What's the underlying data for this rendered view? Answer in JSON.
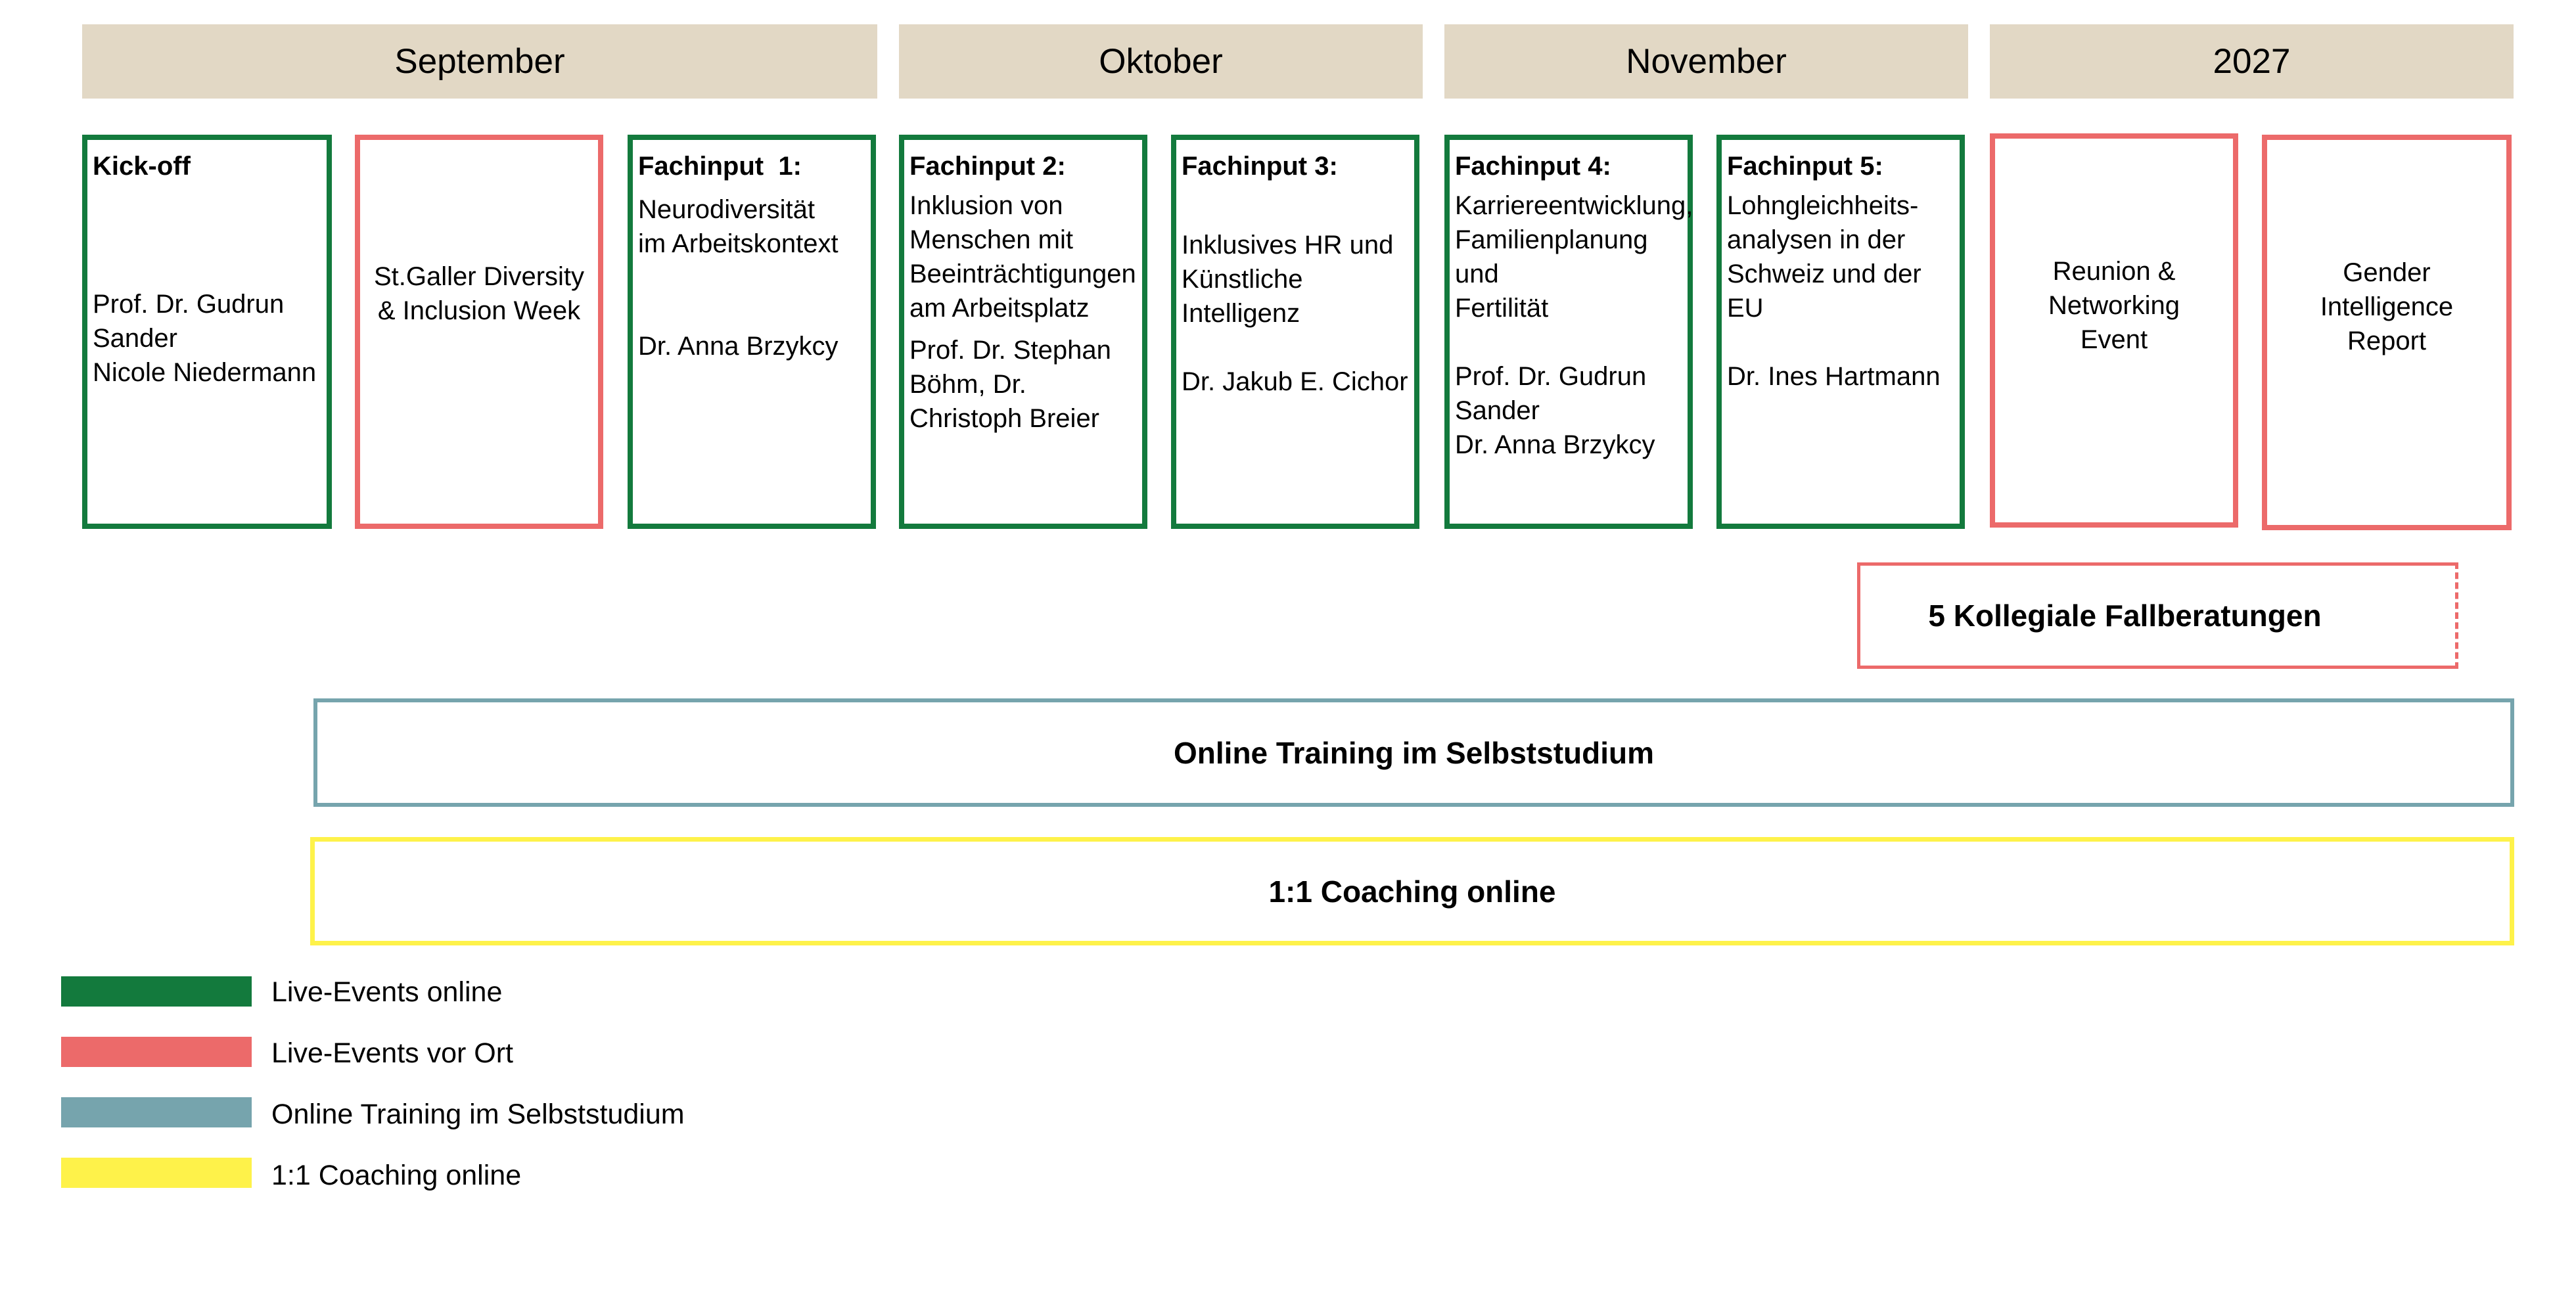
{
  "months": [
    "September",
    "Oktober",
    "November",
    "2027"
  ],
  "cards": {
    "kickoff": {
      "title": "Kick-off",
      "lines": [
        "Prof. Dr. Gudrun",
        "Sander",
        "Nicole Niedermann"
      ]
    },
    "stgaller": {
      "lines": [
        "St.Galler Diversity",
        "& Inclusion Week"
      ]
    },
    "fach1": {
      "title": "Fachinput  1:",
      "topic": [
        "Neurodiversität",
        "im Arbeitskontext"
      ],
      "speakers": [
        "Dr. Anna Brzykcy"
      ]
    },
    "fach2": {
      "title": "Fachinput 2:",
      "topic": [
        "Inklusion von",
        "Menschen mit",
        "Beeinträchtigungen",
        "am Arbeitsplatz"
      ],
      "speakers": [
        "Prof. Dr. Stephan",
        "Böhm, Dr.",
        "Christoph Breier"
      ]
    },
    "fach3": {
      "title": "Fachinput 3:",
      "topic": [
        "Inklusives HR und",
        "Künstliche Intelligenz"
      ],
      "speakers": [
        "Dr. Jakub E. Cichor"
      ]
    },
    "fach4": {
      "title": "Fachinput 4:",
      "topic": [
        "Karriereentwicklung,",
        "Familienplanung und",
        "Fertilität"
      ],
      "speakers": [
        "Prof. Dr. Gudrun",
        "Sander",
        "Dr. Anna Brzykcy"
      ]
    },
    "fach5": {
      "title": "Fachinput 5:",
      "topic": [
        "Lohngleichheits-",
        "analysen in der",
        "Schweiz und der EU"
      ],
      "speakers": [
        "Dr. Ines Hartmann"
      ]
    },
    "reunion": {
      "lines": [
        "Reunion &",
        "Networking",
        "Event"
      ]
    },
    "gender": {
      "lines": [
        "Gender",
        "Intelligence",
        "Report"
      ]
    }
  },
  "bars": {
    "fallberatungen": "5 Kollegiale Fallberatungen",
    "online_training": "Online Training im Selbststudium",
    "coaching": "1:1 Coaching online"
  },
  "legend": [
    {
      "label": "Live-Events online",
      "color": "#137a3d"
    },
    {
      "label": "Live-Events vor Ort",
      "color": "#ec6a6a"
    },
    {
      "label": "Online Training im Selbststudium",
      "color": "#76a4ad"
    },
    {
      "label": "1:1 Coaching online",
      "color": "#fef24a"
    }
  ]
}
